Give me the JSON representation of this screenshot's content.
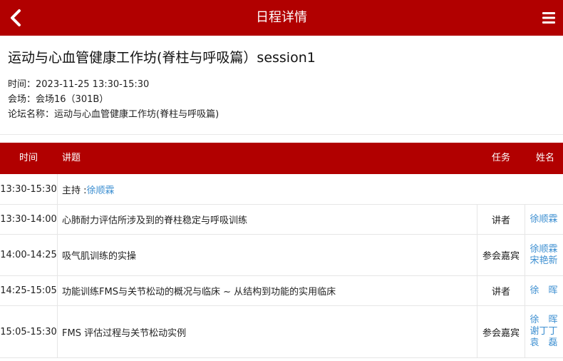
{
  "header": {
    "title": "日程详情",
    "back_icon": "chevron-left-icon",
    "menu_icon": "hamburger-menu-icon",
    "bar_color": "#b10000"
  },
  "session": {
    "title": "运动与心血管健康工作坊(脊柱与呼吸篇）session1",
    "time": "时间：2023-11-25 13:30-15:30",
    "venue": "会场：会场16（301B）",
    "forum": "论坛名称：运动与心血管健康工作坊(脊柱与呼吸篇)"
  },
  "table": {
    "headers": {
      "time": "时间",
      "topic": "讲题",
      "role": "任务",
      "name": "姓名"
    },
    "host_row": {
      "time": "13:30-15:30",
      "label": "主持 : ",
      "name": "徐顺霖"
    },
    "rows": [
      {
        "time": "13:30-14:00",
        "topic": "心肺耐力评估所涉及到的脊柱稳定与呼吸训练",
        "role": "讲者",
        "names": [
          "徐顺霖"
        ]
      },
      {
        "time": "14:00-14:25",
        "topic": "吸气肌训练的实操",
        "role": "参会嘉宾",
        "names": [
          "徐顺霖",
          "宋艳新"
        ]
      },
      {
        "time": "14:25-15:05",
        "topic": "功能训练FMS与关节松动的概况与临床 ~ 从结构到功能的实用临床",
        "role": "讲者",
        "names": [
          "徐　晖"
        ]
      },
      {
        "time": "15:05-15:30",
        "topic": "FMS 评估过程与关节松动实例",
        "role": "参会嘉宾",
        "names": [
          "徐　晖",
          "谢丁丁",
          "袁　磊"
        ]
      }
    ]
  }
}
